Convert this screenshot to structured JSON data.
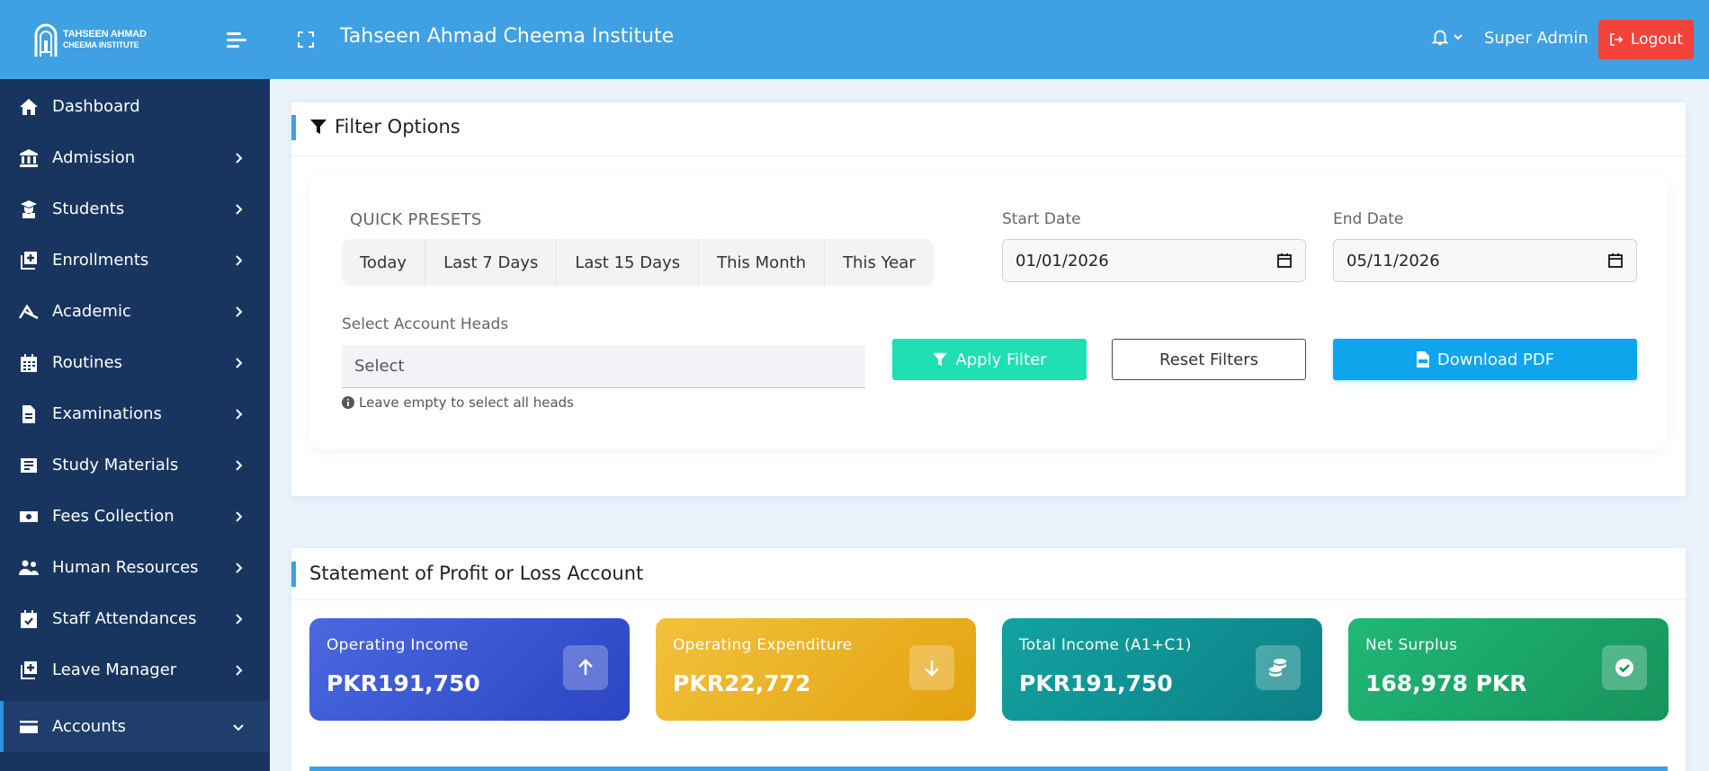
{
  "header": {
    "logo_line1": "TAHSEEN AHMAD",
    "logo_line2": "CHEEMA INSTITUTE",
    "title": "Tahseen Ahmad Cheema Institute",
    "user": "Super Admin",
    "logout_label": "Logout"
  },
  "sidebar": {
    "items": [
      {
        "label": "Dashboard"
      },
      {
        "label": "Admission"
      },
      {
        "label": "Students"
      },
      {
        "label": "Enrollments"
      },
      {
        "label": "Academic"
      },
      {
        "label": "Routines"
      },
      {
        "label": "Examinations"
      },
      {
        "label": "Study Materials"
      },
      {
        "label": "Fees Collection"
      },
      {
        "label": "Human Resources"
      },
      {
        "label": "Staff Attendances"
      },
      {
        "label": "Leave Manager"
      },
      {
        "label": "Accounts"
      }
    ]
  },
  "filter": {
    "title": "Filter Options",
    "quick_presets_label": "QUICK PRESETS",
    "presets": [
      "Today",
      "Last 7 Days",
      "Last 15 Days",
      "This Month",
      "This Year"
    ],
    "start_date_label": "Start Date",
    "start_date_value": "01/01/2026",
    "end_date_label": "End Date",
    "end_date_value": "05/11/2026",
    "account_heads_label": "Select Account Heads",
    "account_heads_placeholder": "Select",
    "hint": "Leave empty to select all heads",
    "apply_label": "Apply Filter",
    "reset_label": "Reset Filters",
    "pdf_label": "Download PDF"
  },
  "statement": {
    "title": "Statement of Profit or Loss Account",
    "cards": [
      {
        "label": "Operating Income",
        "value": "PKR191,750"
      },
      {
        "label": "Operating Expenditure",
        "value": "PKR22,772"
      },
      {
        "label": "Total Income (A1+C1)",
        "value": "PKR191,750"
      },
      {
        "label": "Net Surplus",
        "value": "168,978 PKR"
      }
    ]
  },
  "colors": {
    "topbar": "#3fa0e3",
    "sidebar": "#18355f",
    "logout": "#f2423a",
    "apply": "#1fe0b2",
    "pdf": "#0ea5ec"
  }
}
